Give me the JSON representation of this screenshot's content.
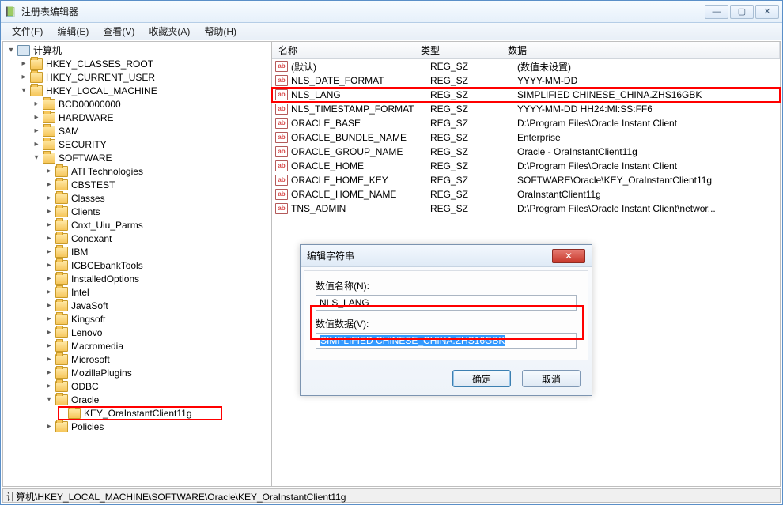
{
  "window": {
    "title": "注册表编辑器"
  },
  "menu": [
    "文件(F)",
    "编辑(E)",
    "查看(V)",
    "收藏夹(A)",
    "帮助(H)"
  ],
  "tree": {
    "root": "计算机",
    "hives": [
      {
        "label": "HKEY_CLASSES_ROOT",
        "children": false
      },
      {
        "label": "HKEY_CURRENT_USER",
        "children": false
      },
      {
        "label": "HKEY_LOCAL_MACHINE",
        "children": true,
        "expanded": true,
        "sub": [
          {
            "label": "BCD00000000"
          },
          {
            "label": "HARDWARE"
          },
          {
            "label": "SAM"
          },
          {
            "label": "SECURITY"
          },
          {
            "label": "SOFTWARE",
            "expanded": true,
            "sub": [
              {
                "label": "ATI Technologies"
              },
              {
                "label": "CBSTEST"
              },
              {
                "label": "Classes"
              },
              {
                "label": "Clients"
              },
              {
                "label": "Cnxt_Uiu_Parms"
              },
              {
                "label": "Conexant"
              },
              {
                "label": "IBM"
              },
              {
                "label": "ICBCEbankTools"
              },
              {
                "label": "InstalledOptions"
              },
              {
                "label": "Intel"
              },
              {
                "label": "JavaSoft"
              },
              {
                "label": "Kingsoft"
              },
              {
                "label": "Lenovo"
              },
              {
                "label": "Macromedia"
              },
              {
                "label": "Microsoft"
              },
              {
                "label": "MozillaPlugins"
              },
              {
                "label": "ODBC"
              },
              {
                "label": "Oracle",
                "expanded": true,
                "sub": [
                  {
                    "label": "KEY_OraInstantClient11g",
                    "highlight": true
                  }
                ]
              },
              {
                "label": "Policies"
              }
            ]
          }
        ]
      }
    ]
  },
  "list": {
    "headers": {
      "name": "名称",
      "type": "类型",
      "data": "数据"
    },
    "rows": [
      {
        "name": "(默认)",
        "type": "REG_SZ",
        "data": "(数值未设置)"
      },
      {
        "name": "NLS_DATE_FORMAT",
        "type": "REG_SZ",
        "data": "YYYY-MM-DD"
      },
      {
        "name": "NLS_LANG",
        "type": "REG_SZ",
        "data": "SIMPLIFIED CHINESE_CHINA.ZHS16GBK",
        "highlight": true
      },
      {
        "name": "NLS_TIMESTAMP_FORMAT",
        "type": "REG_SZ",
        "data": "YYYY-MM-DD HH24:MI:SS:FF6"
      },
      {
        "name": "ORACLE_BASE",
        "type": "REG_SZ",
        "data": "D:\\Program Files\\Oracle Instant Client"
      },
      {
        "name": "ORACLE_BUNDLE_NAME",
        "type": "REG_SZ",
        "data": "Enterprise"
      },
      {
        "name": "ORACLE_GROUP_NAME",
        "type": "REG_SZ",
        "data": "Oracle - OraInstantClient11g"
      },
      {
        "name": "ORACLE_HOME",
        "type": "REG_SZ",
        "data": "D:\\Program Files\\Oracle Instant Client"
      },
      {
        "name": "ORACLE_HOME_KEY",
        "type": "REG_SZ",
        "data": "SOFTWARE\\Oracle\\KEY_OraInstantClient11g"
      },
      {
        "name": "ORACLE_HOME_NAME",
        "type": "REG_SZ",
        "data": "OraInstantClient11g"
      },
      {
        "name": "TNS_ADMIN",
        "type": "REG_SZ",
        "data": "D:\\Program Files\\Oracle Instant Client\\networ..."
      }
    ]
  },
  "dialog": {
    "title": "编辑字符串",
    "name_label": "数值名称(N):",
    "name_value": "NLS_LANG",
    "data_label": "数值数据(V):",
    "data_value": "SIMPLIFIED CHINESE_CHINA.ZHS16GBK",
    "ok": "确定",
    "cancel": "取消"
  },
  "statusbar": "计算机\\HKEY_LOCAL_MACHINE\\SOFTWARE\\Oracle\\KEY_OraInstantClient11g"
}
